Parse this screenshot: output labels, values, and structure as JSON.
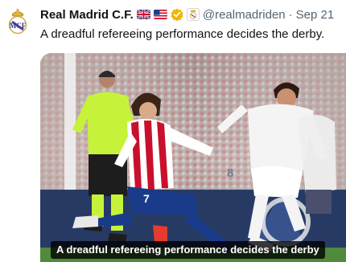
{
  "tweet": {
    "author_name": "Real Madrid C.F.",
    "handle": "@realmadriden",
    "separator": "·",
    "date": "Sep 21",
    "text": "A dreadful refereeing performance decides the derby.",
    "flags": [
      "uk-flag-icon",
      "us-flag-icon"
    ],
    "badges": [
      "verified-badge-icon",
      "affiliate-crest-icon"
    ]
  },
  "media": {
    "caption": "A dreadful refereeing performance decides the derby",
    "player_numbers": [
      "7",
      "8"
    ]
  },
  "colors": {
    "verified": "#f4b400",
    "text": "#0f1419",
    "secondary_text": "#536471",
    "atletico_red": "#c8102e",
    "referee_green": "#c6f23a",
    "madrid_white": "#f4f4f4"
  }
}
